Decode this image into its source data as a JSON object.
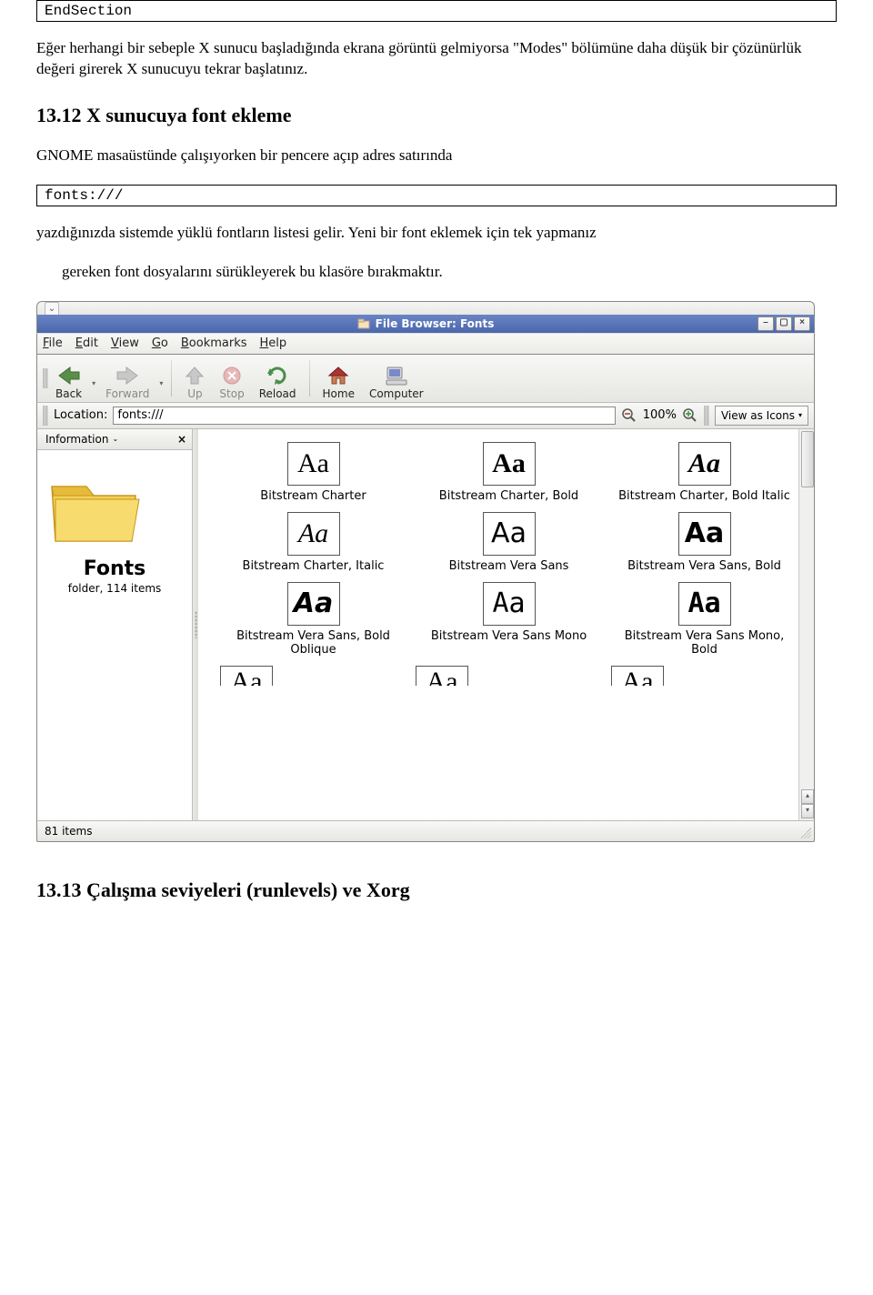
{
  "codebox_top": "EndSection",
  "para1": "Eğer herhangi bir sebeple X sunucu başladığında ekrana görüntü gelmiyorsa \"Modes\" bölümüne daha düşük bir çözünürlük değeri girerek X sunucuyu tekrar başlatınız.",
  "section_font_title": "13.12  X sunucuya font ekleme",
  "para2": "GNOME masaüstünde çalışıyorken bir pencere açıp adres satırında",
  "codebox_fonts": "fonts:///",
  "para3_lead": "yazdığınızda sistemde yüklü fontların listesi gelir. Yeni bir font eklemek için tek yapmanız",
  "para3_rest": "gereken font dosyalarını sürükleyerek bu klasöre bırakmaktır.",
  "filebrowser": {
    "title": "File Browser: Fonts",
    "menubar": [
      "File",
      "Edit",
      "View",
      "Go",
      "Bookmarks",
      "Help"
    ],
    "toolbar": {
      "back": "Back",
      "forward": "Forward",
      "up": "Up",
      "stop": "Stop",
      "reload": "Reload",
      "home": "Home",
      "computer": "Computer"
    },
    "locationbar": {
      "label": "Location:",
      "value": "fonts:///",
      "zoom": "100%",
      "viewas": "View as Icons"
    },
    "sidebar": {
      "panel": "Information",
      "folder": "Fonts",
      "info": "folder, 114 items"
    },
    "fonts": [
      {
        "name": "Bitstream Charter",
        "style": "serif"
      },
      {
        "name": "Bitstream Charter, Bold",
        "style": "serif bold"
      },
      {
        "name": "Bitstream Charter, Bold Italic",
        "style": "serif bold-italic"
      },
      {
        "name": "Bitstream Charter, Italic",
        "style": "serif italic"
      },
      {
        "name": "Bitstream Vera Sans",
        "style": "sans"
      },
      {
        "name": "Bitstream Vera Sans, Bold",
        "style": "sans bold"
      },
      {
        "name": "Bitstream Vera Sans, Bold Oblique",
        "style": "sans oblique"
      },
      {
        "name": "Bitstream Vera Sans Mono",
        "style": "mono"
      },
      {
        "name": "Bitstream Vera Sans Mono, Bold",
        "style": "mono bold"
      }
    ],
    "status": "81 items"
  },
  "section_runlevel_title": "13.13  Çalışma seviyeleri (runlevels) ve Xorg"
}
